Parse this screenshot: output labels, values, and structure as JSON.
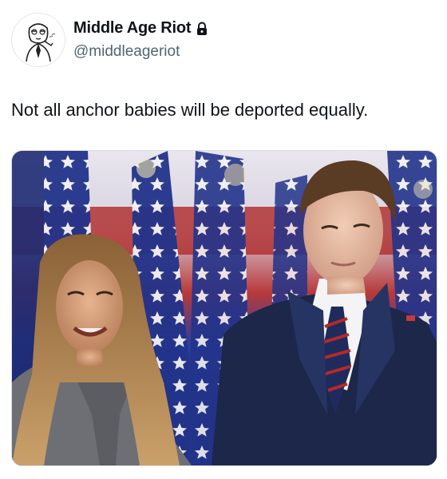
{
  "tweet": {
    "author": {
      "display_name": "Middle Age Riot",
      "handle": "@middleageriot",
      "avatar_icon": "sketch-man-avatar",
      "protected_icon": "lock-icon"
    },
    "text": "Not all anchor babies will be deported equally.",
    "media": {
      "type": "photo",
      "scene": [
        "woman-smiling-left",
        "young-man-suit-right",
        "american-flags-background"
      ]
    }
  },
  "colors": {
    "text_primary": "#0f1419",
    "text_secondary": "#536471",
    "flag_blue": "#23307a",
    "flag_red": "#b52a2a",
    "suit_navy": "#1c2749"
  }
}
